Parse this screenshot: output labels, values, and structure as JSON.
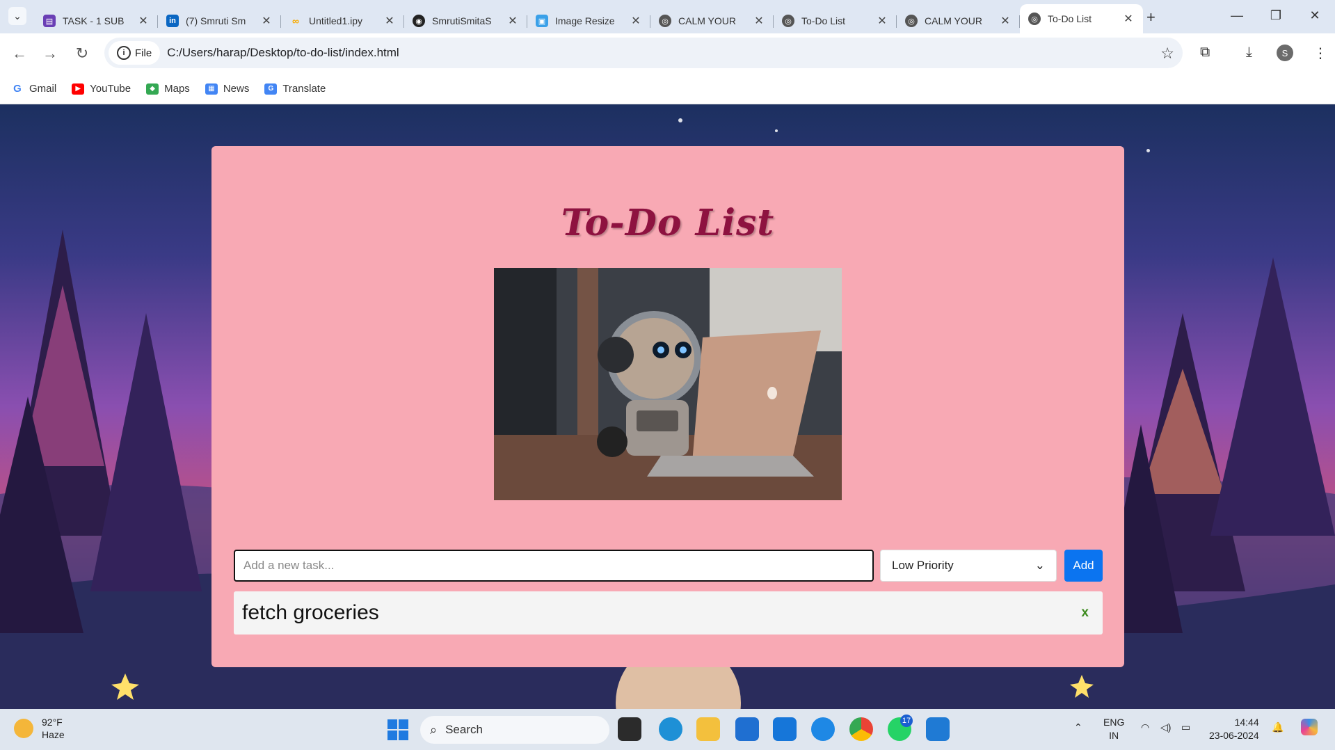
{
  "browser": {
    "tabs": [
      {
        "title": "TASK - 1 SUB",
        "icon": "forms-icon",
        "color": "#6a3fb5"
      },
      {
        "title": "(7) Smruti Sm",
        "icon": "linkedin-icon",
        "color": "#0a66c2"
      },
      {
        "title": "Untitled1.ipy",
        "icon": "colab-icon",
        "color": "#f9ab00"
      },
      {
        "title": "SmrutiSmitaS",
        "icon": "github-icon",
        "color": "#222222"
      },
      {
        "title": "Image Resize",
        "icon": "image-icon",
        "color": "#3aa0e8"
      },
      {
        "title": "CALM YOUR",
        "icon": "globe-icon",
        "color": "#555555"
      },
      {
        "title": "To-Do List",
        "icon": "globe-icon",
        "color": "#555555"
      },
      {
        "title": "CALM YOUR",
        "icon": "globe-icon",
        "color": "#555555"
      },
      {
        "title": "To-Do List",
        "icon": "globe-icon",
        "color": "#555555",
        "active": true
      }
    ],
    "address": {
      "chip": "File",
      "url": "C:/Users/harap/Desktop/to-do-list/index.html"
    },
    "profile_initial": "S",
    "bookmarks": [
      {
        "label": "Gmail",
        "icon": "google-icon",
        "color": "#4285f4"
      },
      {
        "label": "YouTube",
        "icon": "youtube-icon",
        "color": "#ff0000"
      },
      {
        "label": "Maps",
        "icon": "maps-icon",
        "color": "#34a853"
      },
      {
        "label": "News",
        "icon": "news-icon",
        "color": "#4285f4"
      },
      {
        "label": "Translate",
        "icon": "translate-icon",
        "color": "#4285f4"
      }
    ]
  },
  "app": {
    "title": "To-Do List",
    "input_placeholder": "Add a new task...",
    "priority_selected": "Low Priority",
    "add_label": "Add",
    "tasks": [
      {
        "text": "fetch groceries",
        "delete_label": "x"
      }
    ]
  },
  "taskbar": {
    "weather_temp": "92°F",
    "weather_desc": "Haze",
    "search_label": "Search",
    "whatsapp_badge": "17",
    "lang_1": "ENG",
    "lang_2": "IN",
    "time": "14:44",
    "date": "23-06-2024"
  }
}
